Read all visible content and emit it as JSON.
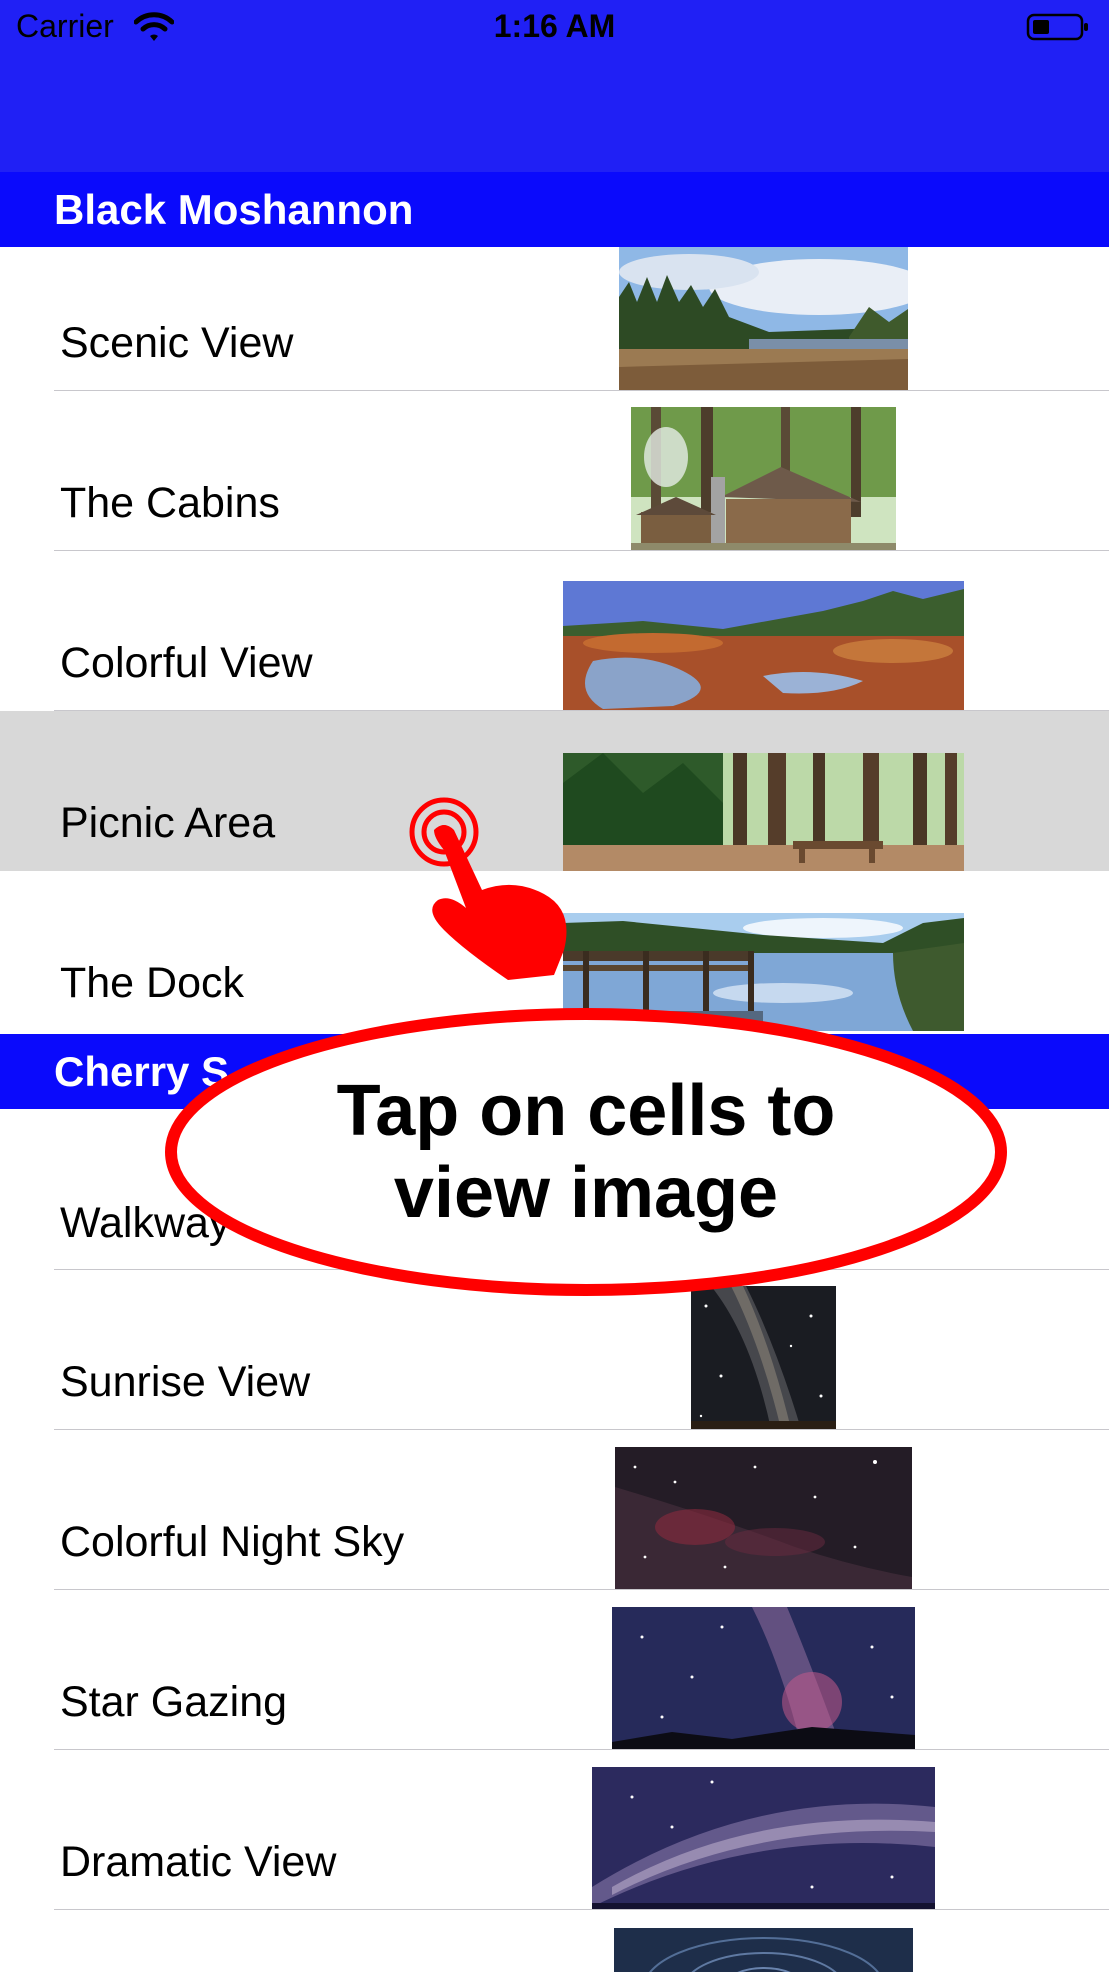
{
  "status_bar": {
    "carrier": "Carrier",
    "time": "1:16 AM"
  },
  "sections": [
    {
      "title": "Black Moshannon",
      "rows": [
        {
          "label": "Scenic View",
          "image": "forest-meadow-photo"
        },
        {
          "label": "The Cabins",
          "image": "log-cabins-photo"
        },
        {
          "label": "Colorful View",
          "image": "red-bog-photo"
        },
        {
          "label": "Picnic Area",
          "image": "picnic-pines-photo",
          "selected": true
        },
        {
          "label": "The Dock",
          "image": "dock-lake-photo"
        }
      ]
    },
    {
      "title": "Cherry S",
      "rows": [
        {
          "label": "Walkway",
          "image": ""
        },
        {
          "label": "Sunrise View",
          "image": "milky-way-photo"
        },
        {
          "label": "Colorful Night Sky",
          "image": "nebula-sky-photo"
        },
        {
          "label": "Star Gazing",
          "image": "purple-milky-way-photo"
        },
        {
          "label": "Dramatic View",
          "image": "arched-milky-way-photo"
        }
      ]
    }
  ],
  "overlay": {
    "line1": "Tap on cells to",
    "line2": "view image"
  },
  "colors": {
    "nav": "#2020f5",
    "section_header": "#0a0afc",
    "selected_row": "#d8d8d8",
    "callout": "#ff0000"
  }
}
